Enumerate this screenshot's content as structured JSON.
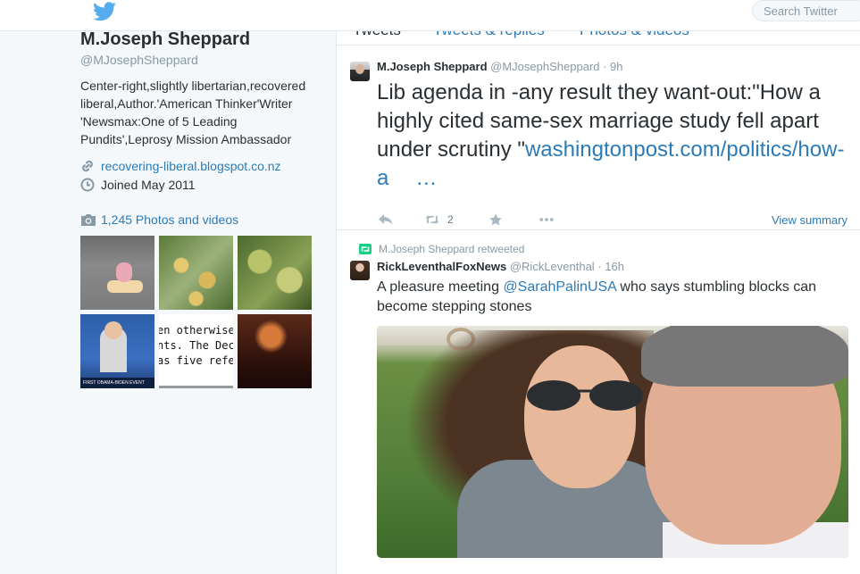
{
  "topbar": {
    "search_placeholder": "Search Twitter"
  },
  "profile": {
    "name": "M.Joseph Sheppard",
    "handle": "@MJosephSheppard",
    "bio": "Center-right,slightly libertarian,recovered liberal,Author.'American Thinker'Writer 'Newsmax:One of 5 Leading Pundits',Leprosy Mission Ambassador",
    "website": "recovering-liberal.blogspot.co.nz",
    "joined": "Joined May 2011",
    "photos_label": "1,245 Photos and videos",
    "thumb5_lines": [
      "en otherwise",
      "nts. The Dec",
      "as five refere"
    ],
    "thumb4_ticker": "FIRST OBAMA-BIDEN EVENT"
  },
  "tabs": [
    "Tweets",
    "Tweets & replies",
    "Photos & videos"
  ],
  "tweet1": {
    "name": "M.Joseph Sheppard",
    "handle": "@MJosephSheppard",
    "time": "· 9h",
    "text": "Lib agenda in -any result they want-out:\"How a highly cited same-sex marriage study fell apart under scrutiny \"",
    "url": "washingtonpost.com/politics/how-a",
    "ellipsis": "…",
    "retweets": "2",
    "view_summary": "View summary"
  },
  "tweet2": {
    "retweeted_by": "M.Joseph Sheppard retweeted",
    "name": "RickLeventhalFoxNews",
    "handle": "@RickLeventhal",
    "time": "· 16h",
    "text_before": "A pleasure meeting ",
    "mention": "@SarahPalinUSA",
    "text_after": " who says stumbling blocks can become stepping stones"
  },
  "colors": {
    "link": "#2b7bb9",
    "muted": "#8899a6",
    "text": "#292f33"
  }
}
